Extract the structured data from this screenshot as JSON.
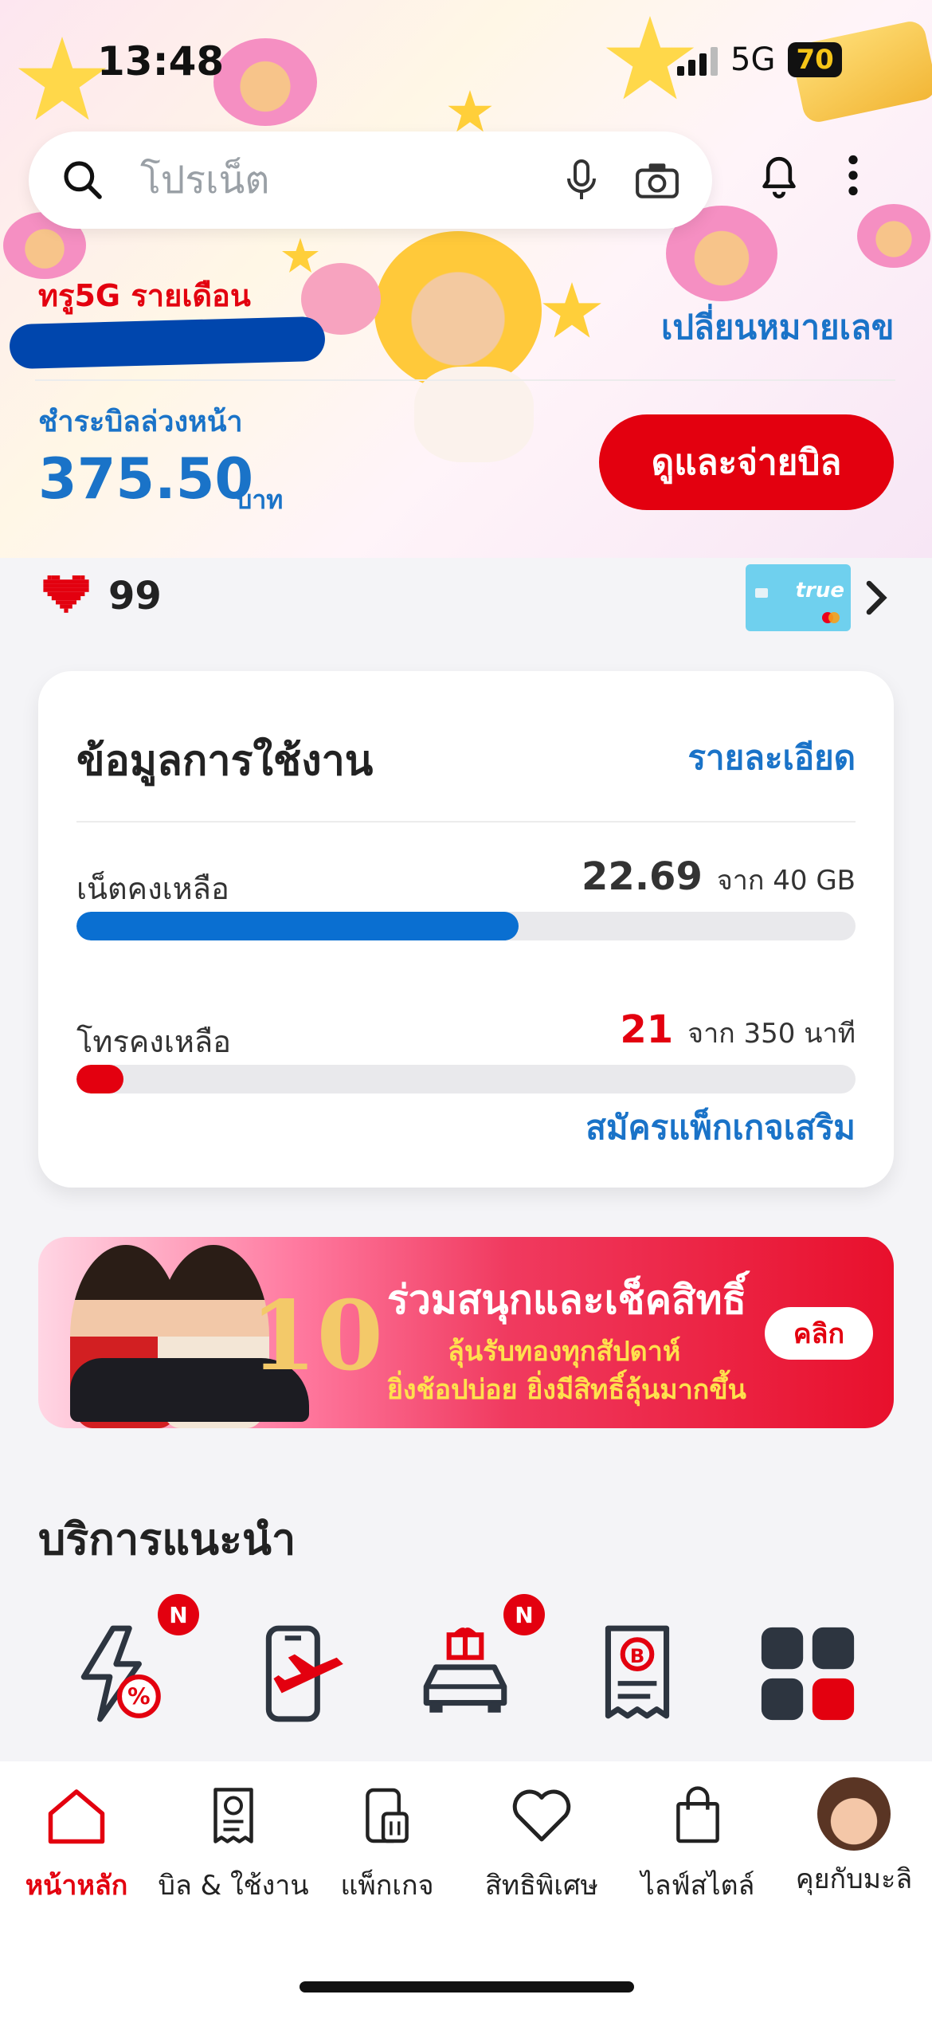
{
  "status": {
    "time": "13:48",
    "network": "5G",
    "battery": "70"
  },
  "search": {
    "placeholder": "โปรเน็ต"
  },
  "account": {
    "plan_name": "ทรู5G รายเดือน",
    "change_number": "เปลี่ยนหมายเลข",
    "prepay_label": "ชำระบิลล่วงหน้า",
    "amount": "375.50",
    "currency": "บาท",
    "pay_button": "ดูและจ่ายบิล"
  },
  "points": {
    "value": "99"
  },
  "card": {
    "brand": "true"
  },
  "usage": {
    "title": "ข้อมูลการใช้งาน",
    "detail_link": "รายละเอียด",
    "data": {
      "label": "เน็ตคงเหลือ",
      "remaining": "22.69",
      "total_text": "จาก 40 GB",
      "fraction": 0.567
    },
    "voice": {
      "label": "โทรคงเหลือ",
      "remaining": "21",
      "total_text": "จาก 350 นาที",
      "fraction": 0.06
    },
    "addon_link": "สมัครแพ็กเกจเสริม"
  },
  "banner": {
    "prize_number": "10",
    "title": "ร่วมสนุกและเช็คสิทธิ์",
    "line1": "ลุ้นรับทองทุกสัปดาห์",
    "line2": "ยิ่งช้อปบ่อย ยิ่งมีสิทธิ์ลุ้นมากขึ้น",
    "button": "คลิก"
  },
  "recommended": {
    "title": "บริการแนะนำ",
    "badge": "N"
  },
  "tabs": [
    {
      "label": "หน้าหลัก"
    },
    {
      "label": "บิล & ใช้งาน"
    },
    {
      "label": "แพ็กเกจ"
    },
    {
      "label": "สิทธิพิเศษ"
    },
    {
      "label": "ไลฟ์สไตล์"
    },
    {
      "label": "คุยกับมะลิ"
    }
  ],
  "colors": {
    "brand_red": "#e3000f",
    "brand_blue": "#1a73c8",
    "data_bar": "#0a6fd1"
  }
}
